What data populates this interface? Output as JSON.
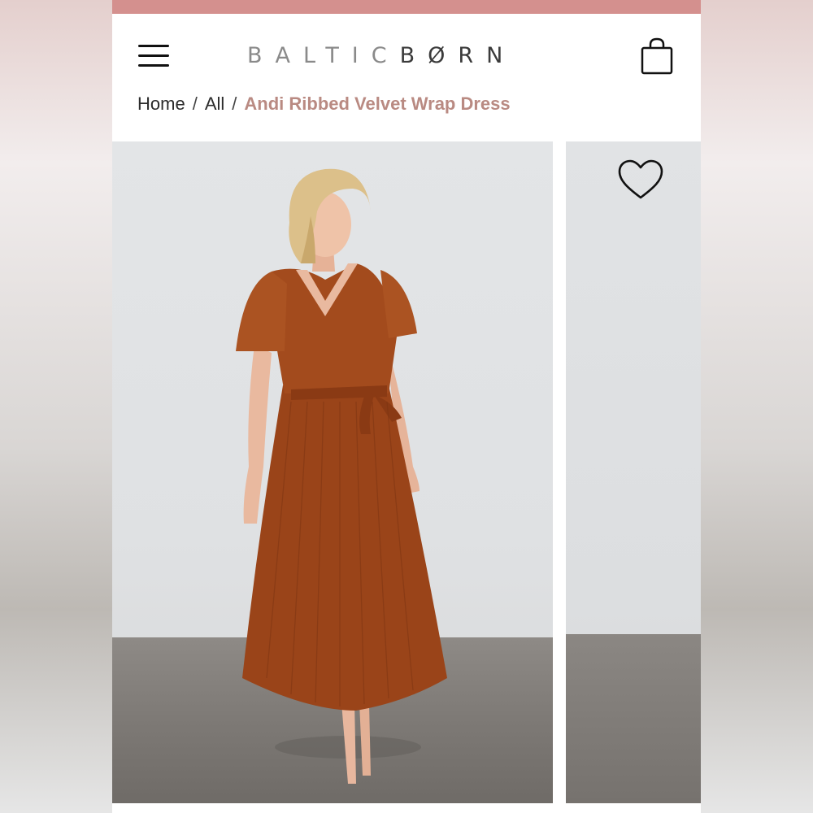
{
  "header": {
    "logo_part1": "BALTIC",
    "logo_part2": "BØRN",
    "menu_icon": "hamburger-menu-icon",
    "bag_icon": "shopping-bag-icon"
  },
  "breadcrumb": {
    "items": [
      "Home",
      "All"
    ],
    "current": "Andi Ribbed Velvet Wrap Dress",
    "separator": "/"
  },
  "gallery": {
    "favorite_icon": "heart-icon"
  },
  "colors": {
    "accent_strip": "#d4908e",
    "breadcrumb_current": "#b98a82",
    "dress": "#9a4419"
  }
}
